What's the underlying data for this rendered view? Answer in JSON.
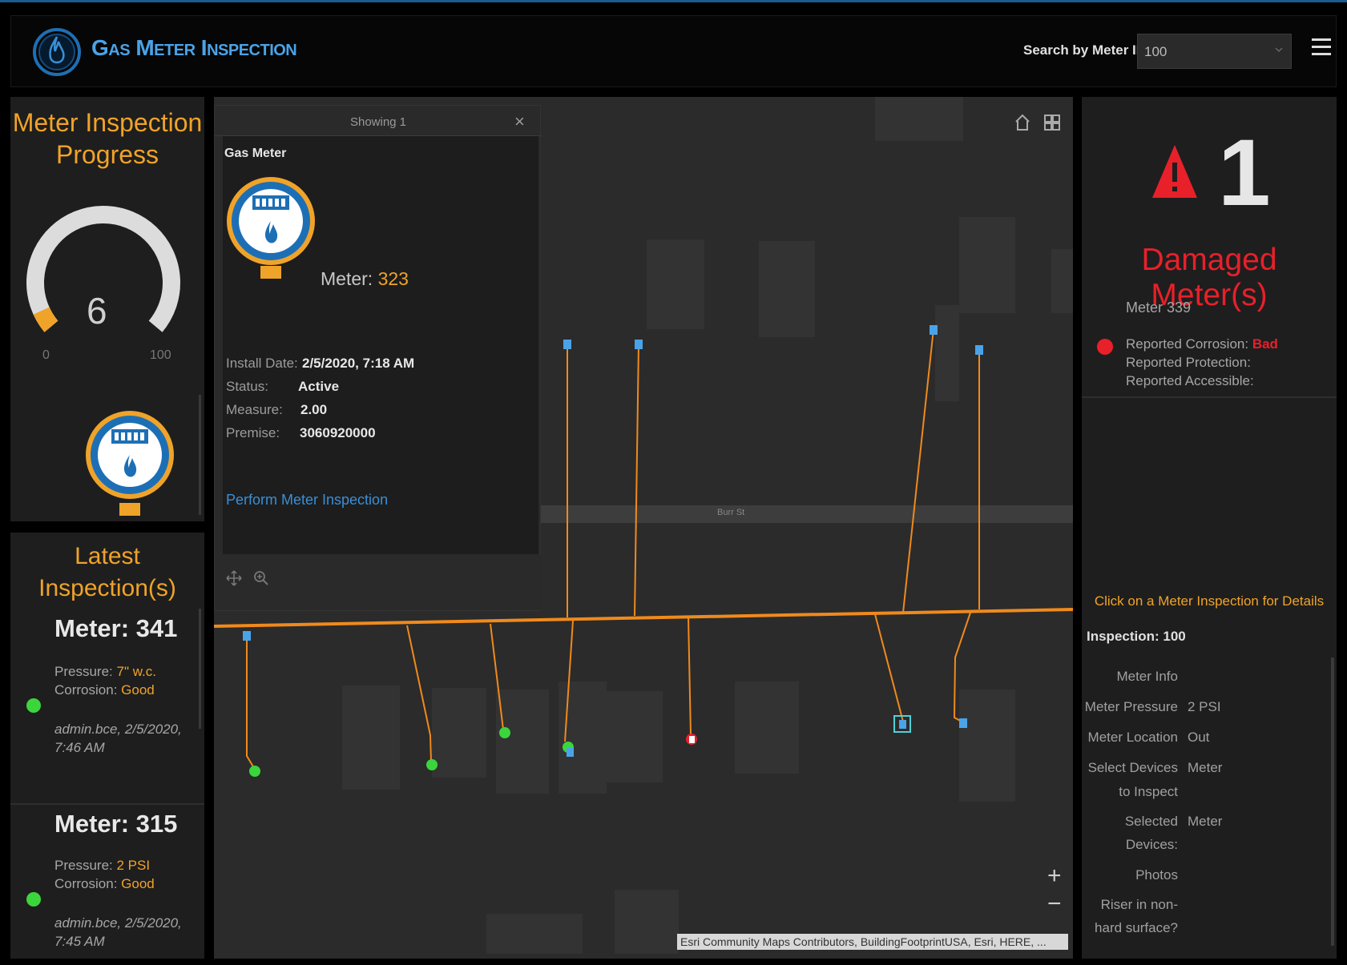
{
  "header": {
    "title": "Gas Meter Inspection",
    "search_label": "Search by Meter ID",
    "search_value": "100"
  },
  "progress": {
    "title_line1": "Meter Inspection",
    "title_line2": "Progress",
    "value": 6,
    "min": "0",
    "max": "100",
    "value_label": "6"
  },
  "latest": {
    "title_line1": "Latest",
    "title_line2": "Inspection(s)",
    "cards": [
      {
        "meter": "Meter: 341",
        "pressure_label": "Pressure:",
        "pressure": "7\" w.c.",
        "corrosion_label": "Corrosion:",
        "corrosion": "Good",
        "admin_line1": "admin.bce, 2/5/2020,",
        "admin_line2": "7:46 AM"
      },
      {
        "meter": "Meter: 315",
        "pressure_label": "Pressure:",
        "pressure": "2 PSI",
        "corrosion_label": "Corrosion:",
        "corrosion": "Good",
        "admin_line1": "admin.bce, 2/5/2020,",
        "admin_line2": "7:45 AM"
      }
    ]
  },
  "popup": {
    "showing": "Showing 1",
    "type": "Gas Meter",
    "meter_label": "Meter:",
    "meter_number": "323",
    "details": [
      {
        "label": "Install Date:",
        "value": "2/5/2020, 7:18 AM"
      },
      {
        "label": "Status:",
        "value": "Active"
      },
      {
        "label": "Measure:",
        "value": "2.00"
      },
      {
        "label": "Premise:",
        "value": "3060920000"
      }
    ],
    "link": "Perform Meter Inspection"
  },
  "map": {
    "road_label": "Burr St",
    "attribution": "Esri Community Maps Contributors, BuildingFootprintUSA, Esri, HERE, ...",
    "zoom_in": "+",
    "zoom_out": "−"
  },
  "damaged": {
    "count": "1",
    "title": "Damaged Meter(s)",
    "meter": "Meter 339",
    "corrosion_label": "Reported Corrosion:",
    "corrosion_value": "Bad",
    "protection_label": "Reported Protection:",
    "accessible_label": "Reported Accessible:"
  },
  "details_panel": {
    "hint": "Click on a Meter Inspection for Details",
    "inspection": "Inspection: 100",
    "rows": [
      {
        "label": "Meter Info",
        "value": ""
      },
      {
        "label": "Meter Pressure",
        "value": "2 PSI"
      },
      {
        "label": "Meter Location",
        "value": "Out"
      },
      {
        "label": "Select Devices",
        "value": "Meter"
      },
      {
        "label": "to Inspect",
        "value": ""
      },
      {
        "label": "Selected",
        "value": "Meter"
      },
      {
        "label": "Devices:",
        "value": ""
      },
      {
        "label": "Photos",
        "value": ""
      },
      {
        "label": "Riser in non-",
        "value": ""
      },
      {
        "label": "hard surface?",
        "value": ""
      }
    ]
  },
  "colors": {
    "accent_orange": "#f0a329",
    "alert_red": "#e8202a",
    "link_blue": "#3a8fd6",
    "status_green": "#3bd63b",
    "gas_line": "#f08a1c"
  }
}
